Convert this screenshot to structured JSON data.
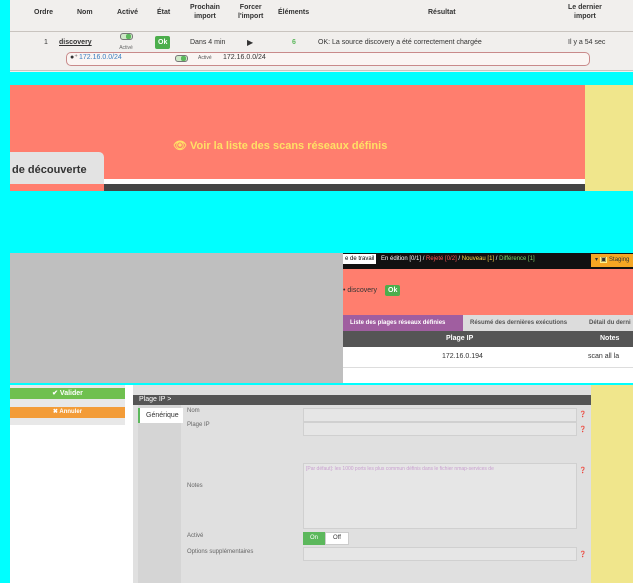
{
  "import_table": {
    "headers": {
      "ordre": "Ordre",
      "nom": "Nom",
      "active": "Activé",
      "etat": "État",
      "prochain_l1": "Prochain",
      "prochain_l2": "import",
      "forcer_l1": "Forcer",
      "forcer_l2": "l'import",
      "elements": "Éléments",
      "resultat": "Résultat",
      "dernier_l1": "Le dernier",
      "dernier_l2": "import"
    },
    "row": {
      "ordre": "1",
      "nom": "discovery",
      "active_label": "Activé",
      "etat": "Ok",
      "prochain": "Dans 4 min",
      "forcer_icon": "▶",
      "elements": "6",
      "resultat": "OK: La source discovery a été correctement chargée",
      "dernier": "Il y a 54 sec"
    },
    "subrow": {
      "range": "172.16.0.0/24",
      "active_label": "Activé",
      "range2": "172.16.0.0/24"
    }
  },
  "banner": {
    "link_text": "Voir la liste des scans réseaux définis",
    "tab_text": "de découverte"
  },
  "network_panel": {
    "topbar": {
      "workspace": "e de travail",
      "edition": "En édition [0/1]",
      "rejected": "Rejeté [0/2]",
      "new": "Nouveau [1]",
      "diff": "Différence [1]",
      "staging": "Staging"
    },
    "source_name": "discovery",
    "source_badge": "Ok",
    "tabs": [
      "Liste des plages réseaux définies",
      "Résumé des dernières exécutions",
      "Détail du derni"
    ],
    "table": {
      "headers": [
        "Plage IP",
        "Notes"
      ],
      "row": [
        "172.16.0.194",
        "scan all la"
      ]
    }
  },
  "form": {
    "valider": "✔ Valider",
    "annuler": "✖ Annuler",
    "header": "Plage IP >",
    "side_tab": "Générique",
    "labels": {
      "nom": "Nom",
      "plage_ip": "Plage IP",
      "notes": "Notes",
      "active": "Activé",
      "options": "Options supplémentaires"
    },
    "notes_placeholder": "[Par défaut]: les 1000 ports les plus commun définis dans le fichier nmap-services de",
    "toggle": {
      "on": "On",
      "off": "Off"
    }
  },
  "colors": {
    "accent_green": "#5cb85c",
    "banner_red": "#ff7e6e",
    "warning_orange": "#f39c38",
    "link_yellow": "#ffe066"
  }
}
